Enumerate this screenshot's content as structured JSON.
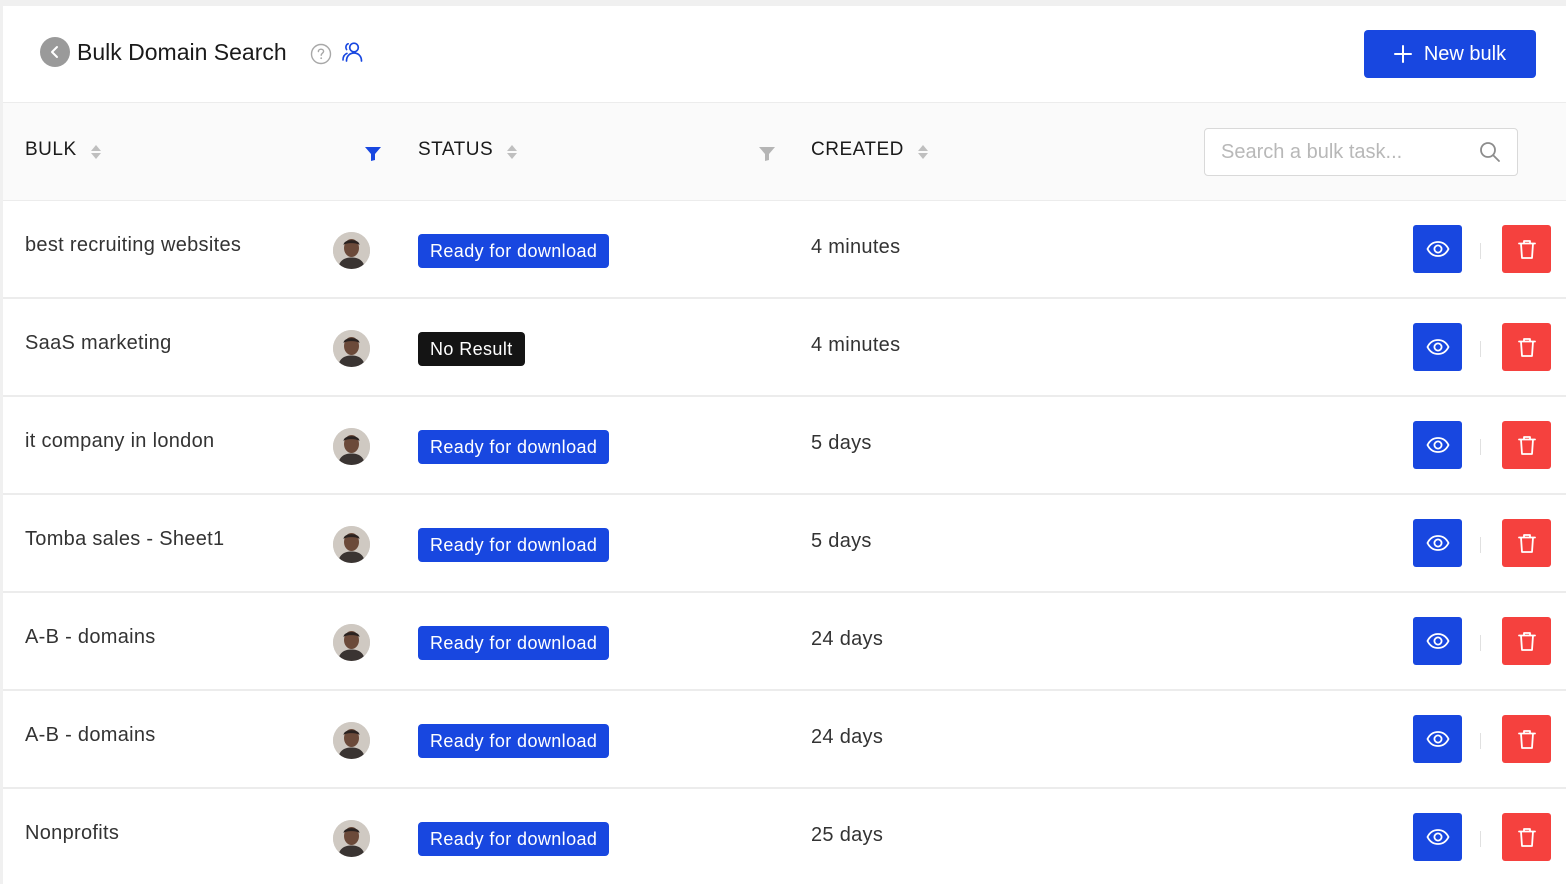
{
  "header": {
    "title": "Bulk Domain Search",
    "new_bulk_label": "New bulk"
  },
  "table": {
    "columns": [
      "BULK",
      "STATUS",
      "CREATED"
    ],
    "search_placeholder": "Search a bulk task..."
  },
  "rows": [
    {
      "name": "best recruiting websites",
      "status": "Ready for download",
      "status_type": "ready",
      "created": "4 minutes"
    },
    {
      "name": "SaaS marketing",
      "status": "No Result",
      "status_type": "none",
      "created": "4 minutes"
    },
    {
      "name": "it company in london",
      "status": "Ready for download",
      "status_type": "ready",
      "created": "5 days"
    },
    {
      "name": "Tomba sales - Sheet1",
      "status": "Ready for download",
      "status_type": "ready",
      "created": "5 days"
    },
    {
      "name": "A-B - domains",
      "status": "Ready for download",
      "status_type": "ready",
      "created": "24 days"
    },
    {
      "name": "A-B - domains",
      "status": "Ready for download",
      "status_type": "ready",
      "created": "24 days"
    },
    {
      "name": "Nonprofits",
      "status": "Ready for download",
      "status_type": "ready",
      "created": "25 days"
    }
  ],
  "icons": {
    "back": "chevron-left-icon",
    "help": "question-circle-icon",
    "team": "team-icon",
    "plus": "plus-icon",
    "filter": "filter-icon",
    "search": "search-icon",
    "view": "eye-icon",
    "delete": "trash-icon"
  },
  "colors": {
    "primary": "#1847e0",
    "danger": "#f5413e",
    "no_result": "#141414"
  }
}
